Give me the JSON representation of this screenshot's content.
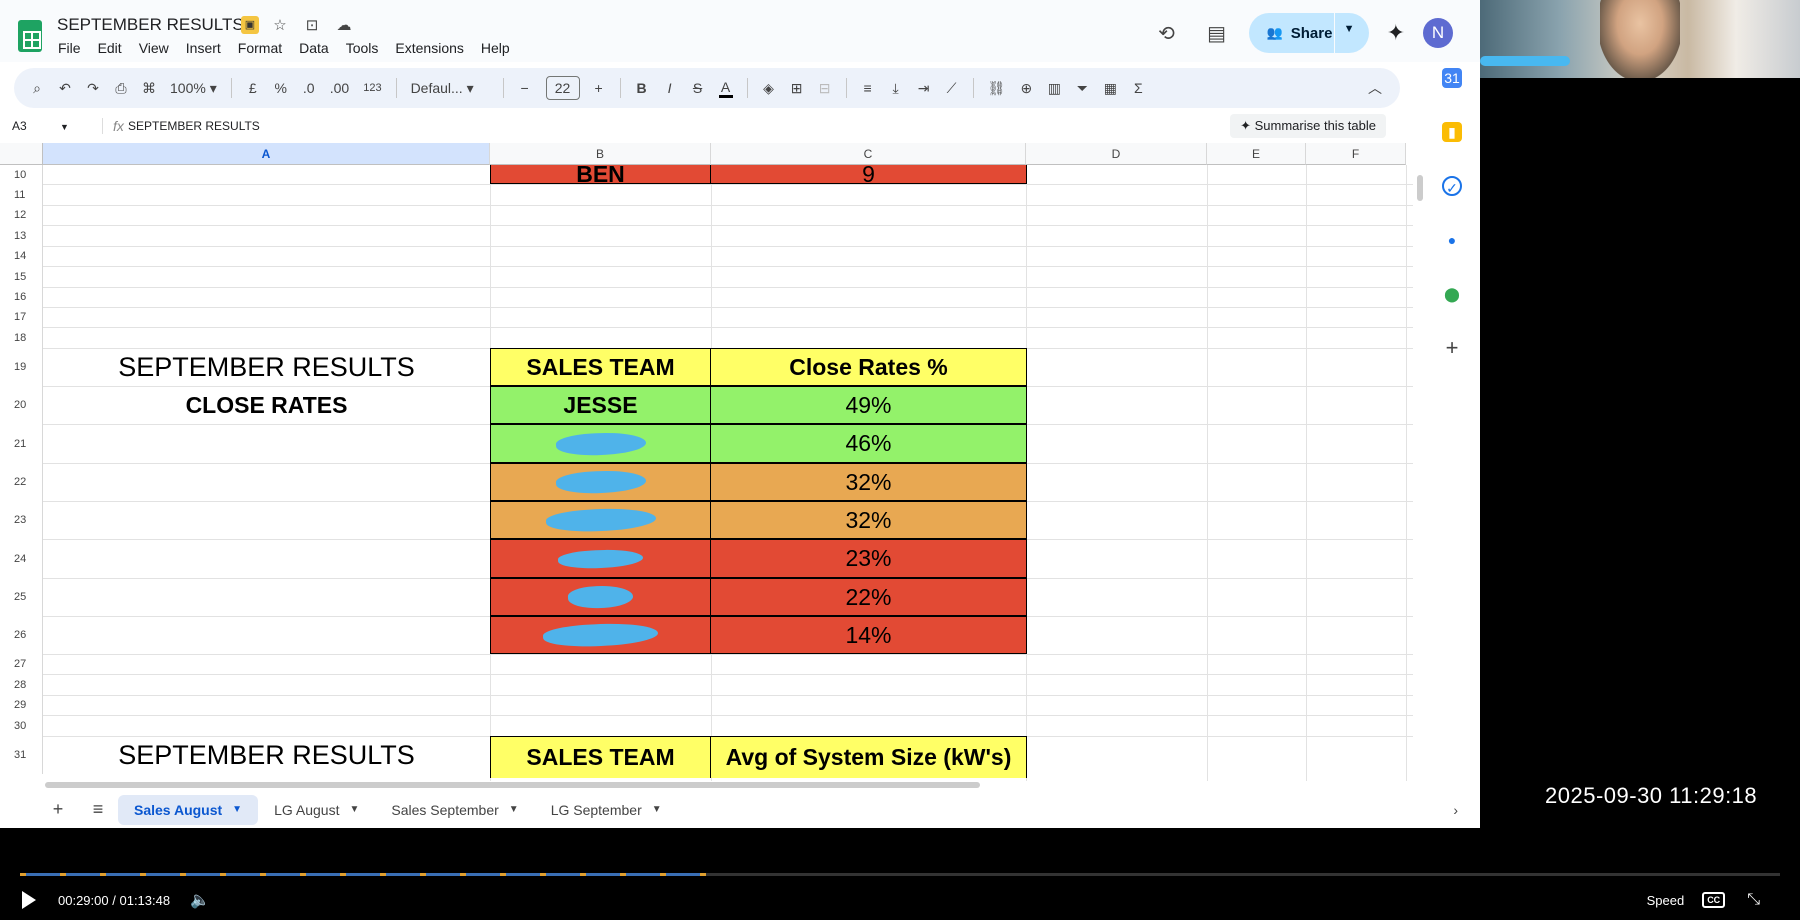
{
  "doc": {
    "title": "SEPTEMBER RESULTS",
    "menu": [
      "File",
      "Edit",
      "View",
      "Insert",
      "Format",
      "Data",
      "Tools",
      "Extensions",
      "Help"
    ],
    "share_label": "Share",
    "avatar_initial": "N"
  },
  "toolbar": {
    "zoom": "100%",
    "currency": "£",
    "percent": "%",
    "dec_decrease": ".0",
    "dec_increase": ".00",
    "number_format": "123",
    "font": "Defaul...",
    "font_size": "22",
    "minus": "−",
    "plus": "+",
    "bold": "B",
    "italic": "I",
    "strike": "S",
    "text_color": "A"
  },
  "formula_bar": {
    "cell_ref": "A3",
    "content": "SEPTEMBER RESULTS",
    "summarise": "Summarise this table"
  },
  "grid": {
    "columns": [
      "A",
      "B",
      "C",
      "D",
      "E",
      "F"
    ],
    "rows": [
      "10",
      "11",
      "12",
      "13",
      "14",
      "15",
      "16",
      "17",
      "18",
      "19",
      "20",
      "21",
      "22",
      "23",
      "24",
      "25",
      "26",
      "27",
      "28",
      "29",
      "30",
      "31"
    ],
    "row10": {
      "name": "BEN",
      "value": "9"
    },
    "block1": {
      "title": "SEPTEMBER RESULTS",
      "subtitle": "CLOSE RATES",
      "header_team": "SALES TEAM",
      "header_metric": "Close Rates %",
      "rows": [
        {
          "name": "JESSE",
          "value": "49%",
          "color": "#93f26a",
          "redacted": false
        },
        {
          "name": "",
          "value": "46%",
          "color": "#93f26a",
          "redacted": true
        },
        {
          "name": "",
          "value": "32%",
          "color": "#e8a852",
          "redacted": true
        },
        {
          "name": "",
          "value": "32%",
          "color": "#e8a852",
          "redacted": true
        },
        {
          "name": "",
          "value": "23%",
          "color": "#e24a34",
          "redacted": true
        },
        {
          "name": "",
          "value": "22%",
          "color": "#e24a34",
          "redacted": true
        },
        {
          "name": "",
          "value": "14%",
          "color": "#e24a34",
          "redacted": true
        }
      ]
    },
    "block2": {
      "title": "SEPTEMBER RESULTS",
      "header_team": "SALES TEAM",
      "header_metric": "Avg of System Size (kW's)"
    }
  },
  "tabs": [
    {
      "label": "Sales August",
      "active": true
    },
    {
      "label": "LG August",
      "active": false
    },
    {
      "label": "Sales September",
      "active": false
    },
    {
      "label": "LG September",
      "active": false
    }
  ],
  "overlay": {
    "timestamp": "2025-09-30  11:29:18"
  },
  "player": {
    "time_current": "00:29:00",
    "time_separator": "/",
    "time_total": "01:13:48",
    "progress": 0.39,
    "speed_label": "Speed",
    "cc_label": "CC"
  },
  "colors": {
    "header_yellow": "#ffff66",
    "green": "#93f26a",
    "orange": "#e8a852",
    "red": "#e24a34",
    "accent": "#0b57d0"
  }
}
